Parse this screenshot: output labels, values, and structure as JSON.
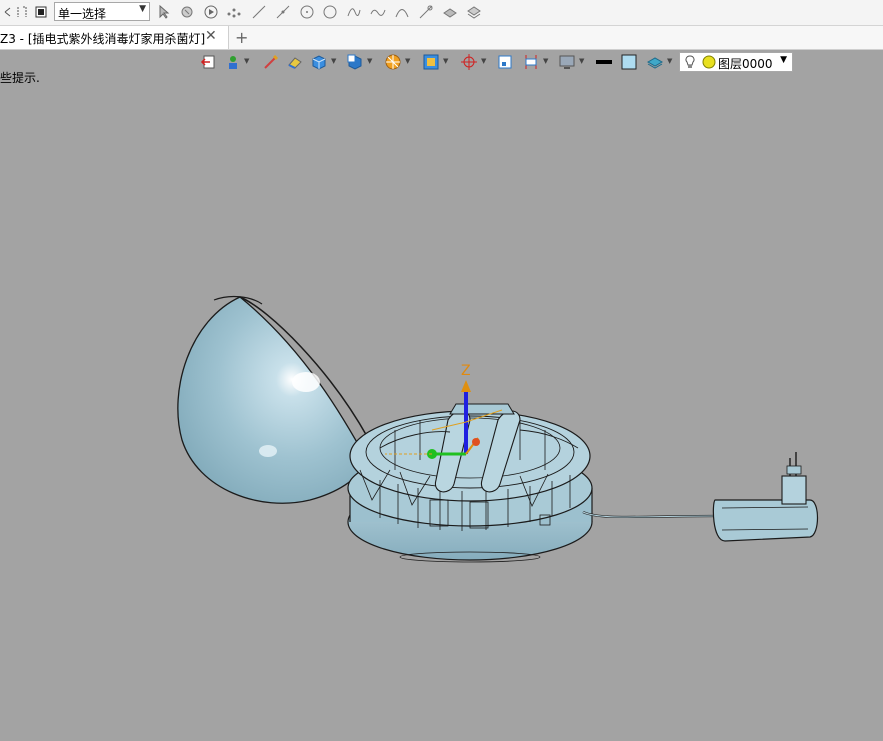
{
  "toolbar": {
    "selection_filter": "单一选择"
  },
  "tabs": [
    {
      "label": "Z3 - [插电式紫外线消毒灯家用杀菌灯]"
    }
  ],
  "view_toolbar": {
    "layer_name": "图层0000"
  },
  "hint_text": "些提示.",
  "axis": {
    "z_label": "Z"
  },
  "colors": {
    "background": "#a3a3a3",
    "model_fill": "#9ec2d0",
    "model_edge": "#1b1b1b"
  }
}
